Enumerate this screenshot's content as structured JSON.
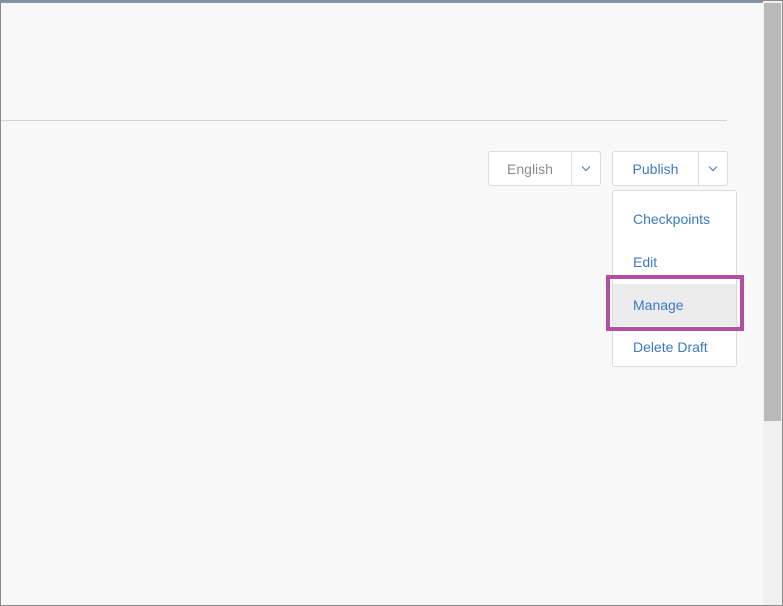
{
  "language": {
    "selected": "English",
    "toggle_icon": "chevron-down-icon"
  },
  "publish": {
    "label": "Publish",
    "toggle_icon": "chevron-down-icon"
  },
  "menu": {
    "items": [
      {
        "label": "Checkpoints"
      },
      {
        "label": "Edit"
      },
      {
        "label": "Manage",
        "highlighted": true
      },
      {
        "label": "Delete Draft"
      }
    ]
  },
  "colors": {
    "link": "#3a7ac4",
    "highlight_border": "#b24fa2",
    "hover_background": "#ececec",
    "top_accent": "#7f97b5"
  }
}
